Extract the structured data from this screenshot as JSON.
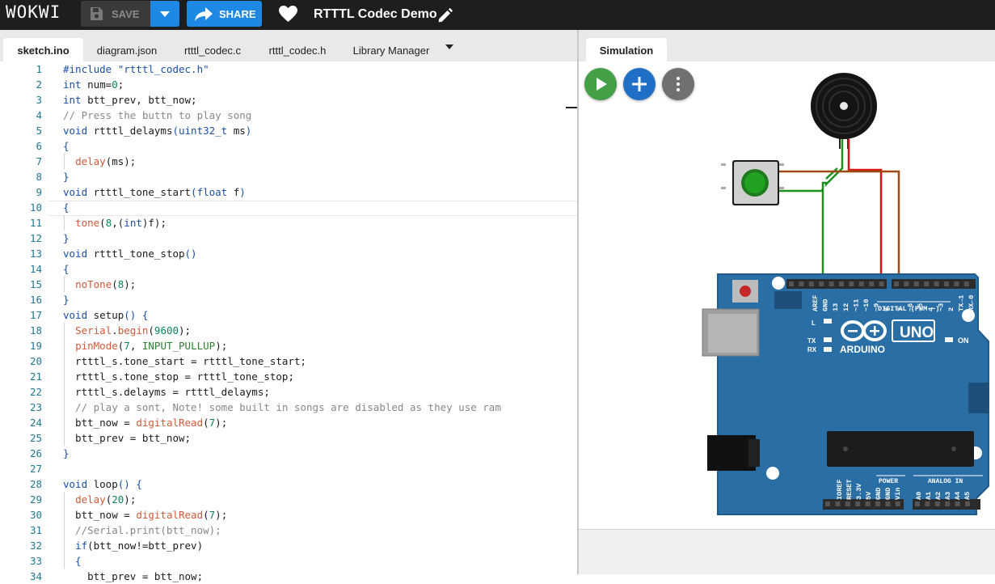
{
  "header": {
    "logo": "WOKWI",
    "save_label": "SAVE",
    "share_label": "SHARE",
    "project_title": "RTTTL Codec Demo"
  },
  "tabs": [
    "sketch.ino",
    "diagram.json",
    "rtttl_codec.c",
    "rtttl_codec.h",
    "Library Manager"
  ],
  "active_tab": "sketch.ino",
  "code_lines": [
    [
      [
        "#include \"rtttl_codec.h\"",
        "k"
      ]
    ],
    [
      [
        "int",
        "t"
      ],
      [
        " num=",
        "p"
      ],
      [
        "0",
        "n"
      ],
      [
        ";",
        "p"
      ]
    ],
    [
      [
        "int",
        "t"
      ],
      [
        " btt_prev, btt_now;",
        "p"
      ]
    ],
    [
      [
        "// Press the buttn to play song",
        "c"
      ]
    ],
    [
      [
        "void",
        "t"
      ],
      [
        " rtttl_delayms",
        "p"
      ],
      [
        "(",
        "k"
      ],
      [
        "uint32_t",
        "t"
      ],
      [
        " ms",
        "p"
      ],
      [
        ")",
        "k"
      ]
    ],
    [
      [
        "{",
        "k"
      ]
    ],
    [
      [
        "  ",
        "p"
      ],
      [
        "delay",
        "r"
      ],
      [
        "(ms);",
        "p"
      ]
    ],
    [
      [
        "}",
        "k"
      ]
    ],
    [
      [
        "void",
        "t"
      ],
      [
        " rtttl_tone_start",
        "p"
      ],
      [
        "(",
        "k"
      ],
      [
        "float",
        "t"
      ],
      [
        " f",
        "p"
      ],
      [
        ")",
        "k"
      ]
    ],
    [
      [
        "{",
        "k"
      ]
    ],
    [
      [
        "  ",
        "p"
      ],
      [
        "tone",
        "r"
      ],
      [
        "(",
        "p"
      ],
      [
        "8",
        "n"
      ],
      [
        ",(",
        "p"
      ],
      [
        "int",
        "t"
      ],
      [
        ")f);",
        "p"
      ]
    ],
    [
      [
        "}",
        "k"
      ]
    ],
    [
      [
        "void",
        "t"
      ],
      [
        " rtttl_tone_stop",
        "p"
      ],
      [
        "()",
        "k"
      ]
    ],
    [
      [
        "{",
        "k"
      ]
    ],
    [
      [
        "  ",
        "p"
      ],
      [
        "noTone",
        "r"
      ],
      [
        "(",
        "p"
      ],
      [
        "8",
        "n"
      ],
      [
        ");",
        "p"
      ]
    ],
    [
      [
        "}",
        "k"
      ]
    ],
    [
      [
        "void",
        "t"
      ],
      [
        " setup",
        "p"
      ],
      [
        "() {",
        "k"
      ]
    ],
    [
      [
        "  ",
        "p"
      ],
      [
        "Serial",
        "r"
      ],
      [
        ".",
        "p"
      ],
      [
        "begin",
        "r"
      ],
      [
        "(",
        "p"
      ],
      [
        "9600",
        "n"
      ],
      [
        ");",
        "p"
      ]
    ],
    [
      [
        "  ",
        "p"
      ],
      [
        "pinMode",
        "r"
      ],
      [
        "(",
        "p"
      ],
      [
        "7",
        "n"
      ],
      [
        ", ",
        "p"
      ],
      [
        "INPUT_PULLUP",
        "s"
      ],
      [
        ");",
        "p"
      ]
    ],
    [
      [
        "  rtttl_s.tone_start = rtttl_tone_start;",
        "p"
      ]
    ],
    [
      [
        "  rtttl_s.tone_stop = rtttl_tone_stop;",
        "p"
      ]
    ],
    [
      [
        "  rtttl_s.delayms = rtttl_delayms;",
        "p"
      ]
    ],
    [
      [
        "  // play a sont, Note! some built in songs are disabled as they use ram",
        "c"
      ]
    ],
    [
      [
        "  btt_now = ",
        "p"
      ],
      [
        "digitalRead",
        "r"
      ],
      [
        "(",
        "p"
      ],
      [
        "7",
        "n"
      ],
      [
        ");",
        "p"
      ]
    ],
    [
      [
        "  btt_prev = btt_now;",
        "p"
      ]
    ],
    [
      [
        "}",
        "k"
      ]
    ],
    [
      [
        "",
        "p"
      ]
    ],
    [
      [
        "void",
        "t"
      ],
      [
        " loop",
        "p"
      ],
      [
        "() {",
        "k"
      ]
    ],
    [
      [
        "  ",
        "p"
      ],
      [
        "delay",
        "r"
      ],
      [
        "(",
        "p"
      ],
      [
        "20",
        "n"
      ],
      [
        ");",
        "p"
      ]
    ],
    [
      [
        "  btt_now = ",
        "p"
      ],
      [
        "digitalRead",
        "r"
      ],
      [
        "(",
        "p"
      ],
      [
        "7",
        "n"
      ],
      [
        ");",
        "p"
      ]
    ],
    [
      [
        "  //Serial.print(btt_now);",
        "c"
      ]
    ],
    [
      [
        "  ",
        "p"
      ],
      [
        "if",
        "t"
      ],
      [
        "(btt_now!=btt_prev)",
        "p"
      ]
    ],
    [
      [
        "  {",
        "k"
      ]
    ],
    [
      [
        "    btt_prev = btt_now;",
        "p"
      ]
    ]
  ],
  "simulation": {
    "tab_label": "Simulation",
    "board": {
      "brand": "ARDUINO",
      "model": "UNO",
      "on_label": "ON",
      "tx_label": "TX",
      "rx_label": "RX",
      "l_label": "L",
      "digital_label": "DIGITAL (PWM ~)",
      "power_label": "POWER",
      "analog_label": "ANALOG IN",
      "digital_pins": [
        "AREF",
        "GND",
        "13",
        "12",
        "~11",
        "~10",
        "~9",
        "8",
        "7",
        "~6",
        "~5",
        "4",
        "~3",
        "2",
        "TX→1",
        "RX←0"
      ],
      "power_pins": [
        "IOREF",
        "RESET",
        "3.3V",
        "5V",
        "GND",
        "GND",
        "Vin"
      ],
      "analog_pins": [
        "A0",
        "A1",
        "A2",
        "A3",
        "A4",
        "A5"
      ]
    }
  },
  "colors": {
    "topbar": "#1e1e1e",
    "accent": "#1e88e5",
    "play": "#43a047",
    "board": "#2a6ea6",
    "wire_green": "#1f8f1f",
    "wire_red": "#e01010",
    "wire_brown": "#9a4a14"
  }
}
